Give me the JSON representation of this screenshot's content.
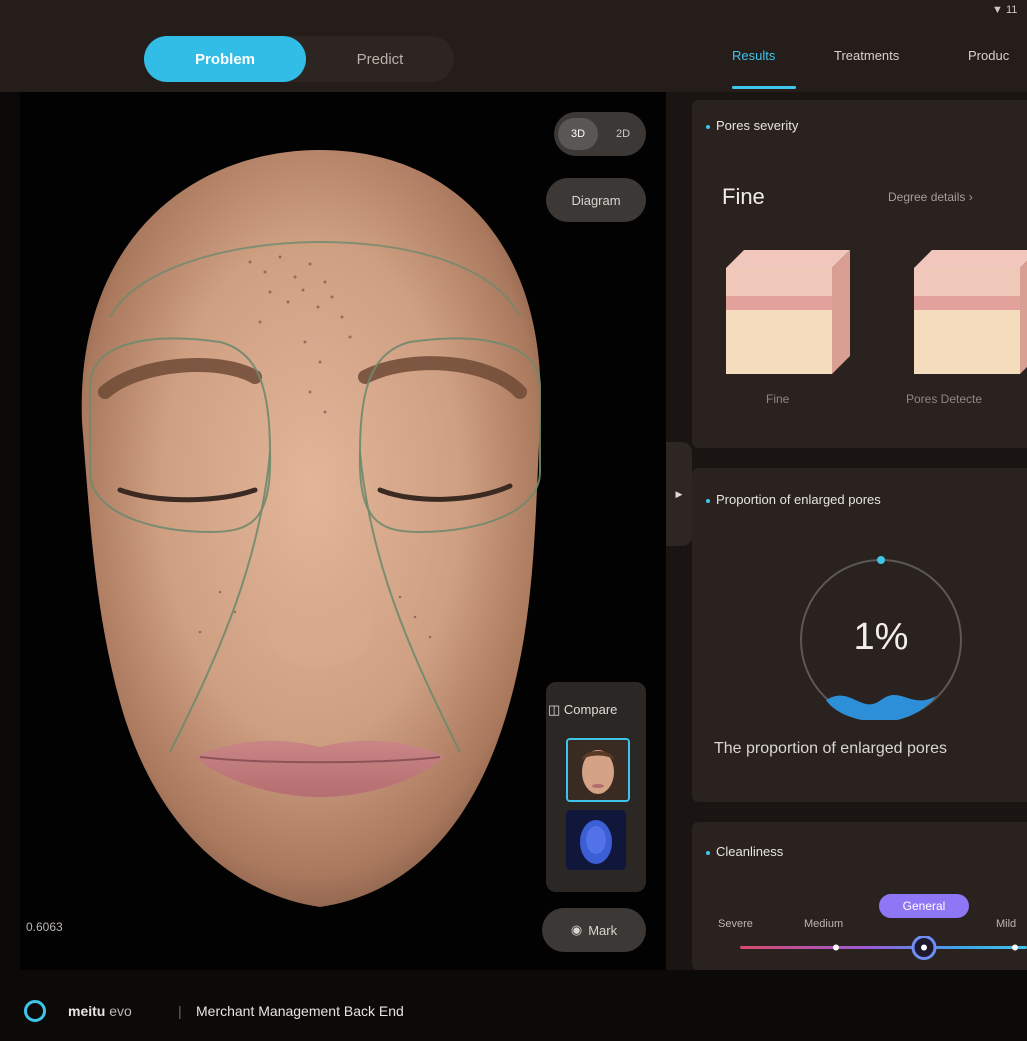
{
  "status_bar": {
    "wifi_text": "▼ 11"
  },
  "mode_switch": {
    "active": "Problem",
    "inactive": "Predict"
  },
  "right_tabs": [
    {
      "label": "Results"
    },
    {
      "label": "Treatments"
    },
    {
      "label": "Produc"
    }
  ],
  "viewer": {
    "toggle_3d": "3D",
    "toggle_2d": "2D",
    "diagram_label": "Diagram",
    "compare_label": "Compare",
    "mark_label": "Mark",
    "coordinate": "0.6063"
  },
  "pores_card": {
    "title": "Pores severity",
    "level": "Fine",
    "degree_details": "Degree details",
    "cubes": [
      {
        "label": "Fine"
      },
      {
        "label": "Pores Detecte"
      }
    ]
  },
  "proportion_card": {
    "title": "Proportion of enlarged pores",
    "value": "1%",
    "value_fraction": 0.01,
    "caption": "The proportion of enlarged pores"
  },
  "cleanliness_card": {
    "title": "Cleanliness",
    "levels": [
      "Severe",
      "Medium",
      "General",
      "Mild"
    ],
    "selected": "General"
  },
  "footer": {
    "brand_bold": "meitu",
    "brand_light": "evo",
    "separator": "|",
    "subtitle": "Merchant Management Back End"
  },
  "colors": {
    "accent": "#3fc4ec",
    "badge": "#8e77f5",
    "background": "#1a1513"
  }
}
